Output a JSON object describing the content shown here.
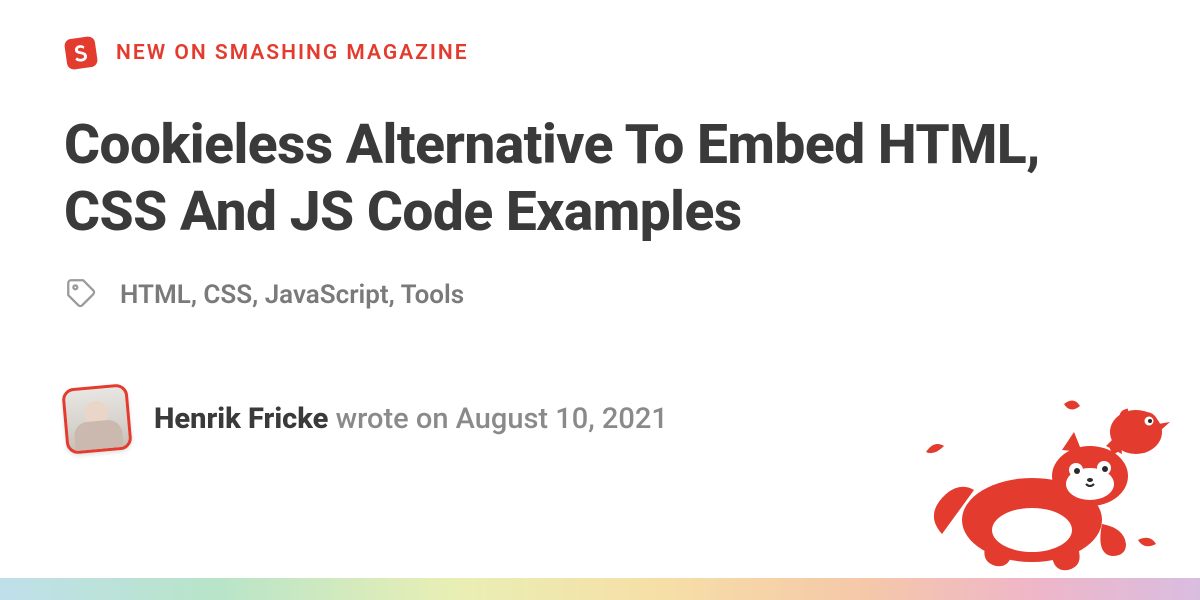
{
  "kicker": "NEW ON SMASHING MAGAZINE",
  "title": "Cookieless Alternative To Embed HTML, CSS And JS Code Examples",
  "tags": "HTML, CSS, JavaScript, Tools",
  "author": "Henrik Fricke",
  "byline_middle": " wrote on ",
  "date": "August 10, 2021",
  "brand_color": "#e33b2e"
}
